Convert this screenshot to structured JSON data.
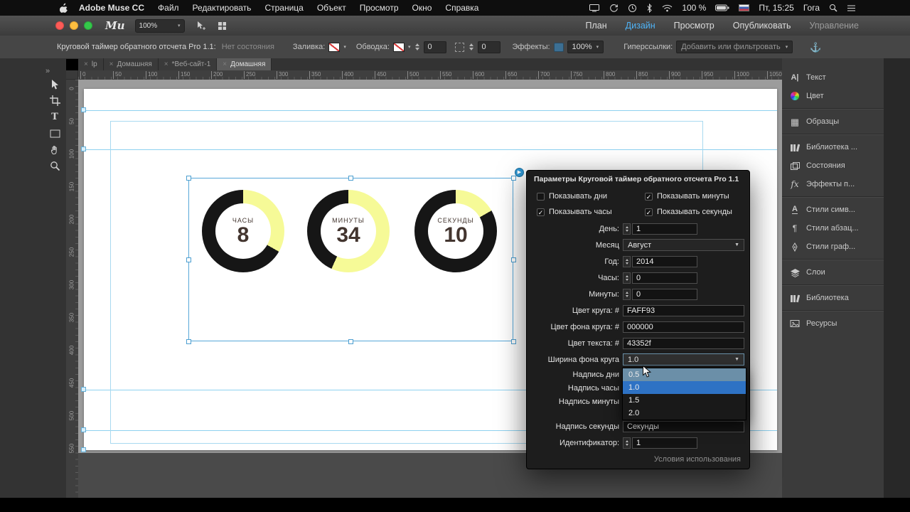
{
  "menubar": {
    "app_name": "Adobe Muse CC",
    "menus": [
      "Файл",
      "Редактировать",
      "Страница",
      "Объект",
      "Просмотр",
      "Окно",
      "Справка"
    ],
    "battery_label": "100 %",
    "clock": "Пт, 15:25",
    "user": "Гога"
  },
  "titlebar": {
    "logo": "Mu",
    "zoom_value": "100%",
    "nav_tabs": [
      {
        "label": "План",
        "active": false,
        "dim": false
      },
      {
        "label": "Дизайн",
        "active": true,
        "dim": false
      },
      {
        "label": "Просмотр",
        "active": false,
        "dim": false
      },
      {
        "label": "Опубликовать",
        "active": false,
        "dim": false
      },
      {
        "label": "Управление",
        "active": false,
        "dim": true
      }
    ]
  },
  "propbar": {
    "selection_name": "Круговой таймер обратного отсчета Pro 1.1:",
    "selection_state": "Нет состояния",
    "fill_label": "Заливка:",
    "stroke_label": "Обводка:",
    "stroke_value": "0",
    "corner_value": "0",
    "effects_label": "Эффекты:",
    "effects_value": "100%",
    "hyperlinks_label": "Гиперссылки:",
    "hyperlinks_placeholder": "Добавить или фильтровать"
  },
  "doc_tabs": [
    {
      "label": "lp",
      "active": false
    },
    {
      "label": "Домашняя",
      "active": false
    },
    {
      "label": "*Веб-сайт-1",
      "active": false
    },
    {
      "label": "Домашняя",
      "active": true
    }
  ],
  "rulers": {
    "horizontal": [
      "0",
      "50",
      "100",
      "150",
      "200",
      "250",
      "300",
      "350",
      "400",
      "450",
      "500",
      "550",
      "600",
      "650",
      "700",
      "750",
      "800",
      "850",
      "900",
      "950",
      "1000",
      "1050"
    ],
    "vertical": [
      "0",
      "50",
      "100",
      "150",
      "200",
      "250",
      "300",
      "350",
      "400",
      "450",
      "500",
      "550"
    ]
  },
  "toolbar_collapse": "»",
  "tools": [
    "selection-tool",
    "crop-tool",
    "text-tool",
    "rectangle-tool",
    "hand-tool",
    "zoom-tool"
  ],
  "canvas": {
    "timers": [
      {
        "label": "ЧАСЫ",
        "value": "8",
        "fraction": 0.333
      },
      {
        "label": "МИНУТЫ",
        "value": "34",
        "fraction": 0.567
      },
      {
        "label": "СЕКУНДЫ",
        "value": "10",
        "fraction": 0.167
      }
    ],
    "ring_color": "#f6fa97",
    "ring_bg": "#161616",
    "text_color": "#43352f",
    "play_glyph": "▶"
  },
  "widget_panel": {
    "title": "Параметры Круговой таймер обратного отсчета Pro 1.1",
    "checkboxes": [
      {
        "label": "Показывать дни",
        "checked": false
      },
      {
        "label": "Показывать минуты",
        "checked": true
      },
      {
        "label": "Показывать часы",
        "checked": true
      },
      {
        "label": "Показывать секунды",
        "checked": true
      }
    ],
    "rows": [
      {
        "label": "День:",
        "type": "stepper",
        "value": "1"
      },
      {
        "label": "Месяц",
        "type": "select",
        "value": "Август"
      },
      {
        "label": "Год:",
        "type": "stepper",
        "value": "2014"
      },
      {
        "label": "Часы:",
        "type": "stepper",
        "value": "0"
      },
      {
        "label": "Минуты:",
        "type": "stepper",
        "value": "0"
      },
      {
        "label": "Цвет круга: #",
        "type": "text",
        "value": "FAFF93"
      },
      {
        "label": "Цвет фона круга: #",
        "type": "text",
        "value": "000000"
      },
      {
        "label": "Цвет текста: #",
        "type": "text",
        "value": "43352f"
      },
      {
        "label": "Ширина фона круга",
        "type": "select_open",
        "value": "1.0"
      },
      {
        "label": "Надпись дни",
        "type": "covered",
        "value": ""
      },
      {
        "label": "Надпись часы",
        "type": "covered",
        "value": ""
      },
      {
        "label": "Надпись минуты",
        "type": "covered",
        "value": ""
      },
      {
        "label": "Надпись секунды",
        "type": "text",
        "value": "Секунды"
      },
      {
        "label": "Идентификатор:",
        "type": "stepper",
        "value": "1"
      }
    ],
    "dropdown_options": [
      {
        "label": "0.5",
        "state": "hover"
      },
      {
        "label": "1.0",
        "state": "selected"
      },
      {
        "label": "1.5",
        "state": ""
      },
      {
        "label": "2.0",
        "state": ""
      }
    ],
    "terms": "Условия использования"
  },
  "right_panel": {
    "groups": [
      [
        {
          "icon": "text",
          "label": "Текст"
        },
        {
          "icon": "color",
          "label": "Цвет"
        }
      ],
      [
        {
          "icon": "swatches",
          "label": "Образцы"
        }
      ],
      [
        {
          "icon": "widget-library",
          "label": "Библиотека ..."
        },
        {
          "icon": "states",
          "label": "Состояния"
        },
        {
          "icon": "effects",
          "label": "Эффекты п..."
        }
      ],
      [
        {
          "icon": "char-styles",
          "label": "Стили симв..."
        },
        {
          "icon": "para-styles",
          "label": "Стили абзац..."
        },
        {
          "icon": "graphic-styles",
          "label": "Стили граф..."
        }
      ],
      [
        {
          "icon": "layers",
          "label": "Слои"
        }
      ],
      [
        {
          "icon": "library",
          "label": "Библиотека"
        }
      ],
      [
        {
          "icon": "assets",
          "label": "Ресурсы"
        }
      ]
    ]
  }
}
